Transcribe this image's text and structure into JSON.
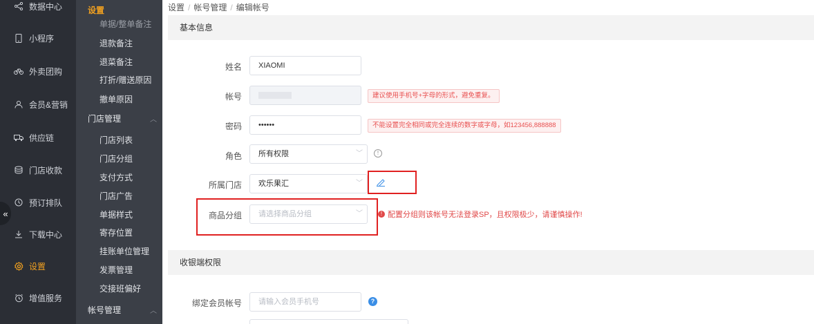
{
  "sidebar": {
    "items": [
      {
        "label": "数据中心",
        "icon": "share-icon"
      },
      {
        "label": "小程序",
        "icon": "phone-icon"
      },
      {
        "label": "外卖团购",
        "icon": "bike-icon"
      },
      {
        "label": "会员&营销",
        "icon": "user-icon"
      },
      {
        "label": "供应链",
        "icon": "truck-icon"
      },
      {
        "label": "门店收款",
        "icon": "wallet-icon"
      },
      {
        "label": "预订排队",
        "icon": "clock-icon"
      },
      {
        "label": "下载中心",
        "icon": "download-icon"
      },
      {
        "label": "设置",
        "icon": "gear-icon"
      },
      {
        "label": "增值服务",
        "icon": "alarm-icon"
      }
    ],
    "collapse_glyph": "«"
  },
  "subnav": {
    "title": "设置",
    "items_top": [
      "单据/整单备注",
      "退款备注",
      "退菜备注",
      "打折/赠送原因",
      "撤单原因"
    ],
    "group_store": "门店管理",
    "store_items": [
      "门店列表",
      "门店分组",
      "支付方式",
      "门店广告",
      "单据样式",
      "寄存位置",
      "挂账单位管理",
      "发票管理",
      "交接班偏好"
    ],
    "group_account": "帐号管理"
  },
  "breadcrumb": [
    "设置",
    "帐号管理",
    "编辑帐号"
  ],
  "sections": {
    "basic": "基本信息",
    "cashier": "收银端权限"
  },
  "form": {
    "name": {
      "label": "姓名",
      "value": "XIAOMI"
    },
    "account": {
      "label": "帐号",
      "hint": "建议使用手机号+字母的形式，避免重复。"
    },
    "password": {
      "label": "密码",
      "value": "••••••",
      "hint": "不能设置完全相同或完全连续的数字或字母，如123456,888888"
    },
    "role": {
      "label": "角色",
      "value": "所有权限"
    },
    "store": {
      "label": "所属门店",
      "value": "欢乐果汇"
    },
    "goods_group": {
      "label": "商品分组",
      "placeholder": "请选择商品分组",
      "warning": "配置分组则该帐号无法登录SP，且权限极少，请谨慎操作!"
    },
    "member": {
      "label": "绑定会员帐号",
      "placeholder": "请输入会员手机号"
    }
  },
  "colors": {
    "accent": "#f0a020",
    "warn_red": "#e04848",
    "highlight_box": "#e02020",
    "help_blue": "#3a8ee6"
  }
}
